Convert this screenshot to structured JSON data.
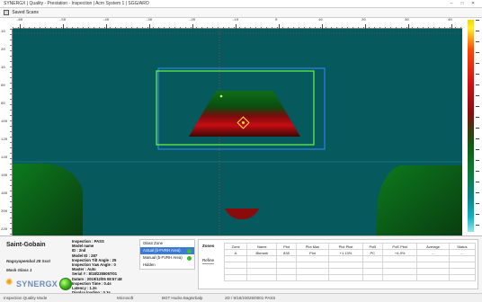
{
  "window": {
    "title": "SYNERGX  |  Quality  -  Prestation  -  Inspection  |  Acm System 1  |  SGG/ARO",
    "controls": [
      "–",
      "□",
      "✕"
    ]
  },
  "toolbar": {
    "label": "Saved Scans"
  },
  "ruler": {
    "top_ticks": [
      "-60",
      "-50",
      "-40",
      "-30",
      "-20",
      "-10",
      "0",
      "10",
      "20",
      "30",
      "40"
    ],
    "left_ticks": [
      "10",
      "20",
      "40",
      "60",
      "80",
      "100",
      "120",
      "140",
      "160",
      "180",
      "200",
      "220"
    ]
  },
  "colors": {
    "plot_bg": "#06595c",
    "dark_green": "#0d5e12",
    "red": "#d40f14",
    "roi_box": "#66ff44",
    "roi_outer": "#3a86ff",
    "marker": "#ffe14d",
    "list_select": "#3b7bd5",
    "status_green": "#3cbc2a"
  },
  "company": {
    "name": "Saint-Gobain",
    "location": "Nagoyapembal 28 Ssst",
    "sub": "Mask Glass 1",
    "logo": "SYNERGX"
  },
  "inspection": {
    "lines": [
      "Inspection : PASS",
      "Model name",
      "ID : 2nd",
      "Model ID : 287",
      "Inspection Tilt Angle : 25",
      "Inspection Yaw Angle : 0",
      "Master : Auto",
      "Serial # : 8/18/2355057/01",
      "Datum : 2019/12/05  08:57:48",
      "Inspection Time : 0.4s",
      "Latency : 1.3s",
      "Display loading : 0.3s"
    ]
  },
  "camera_list": {
    "items": [
      {
        "label": "Glass Zone",
        "selected": false,
        "status": false
      },
      {
        "label": "Actual (b-FVRH Area)",
        "selected": true,
        "status": true
      },
      {
        "label": "Manual (b-FVRH Area)",
        "selected": false,
        "status": true
      },
      {
        "label": "Hidden",
        "selected": false,
        "status": false
      }
    ]
  },
  "zones": {
    "label": "Zones",
    "refine_label": "Refine",
    "headers": [
      "Zone",
      "Name",
      "Plot",
      "Plot Max",
      "Plot Pkst",
      "PoB",
      "PoE Pkst",
      "Average",
      "Status"
    ],
    "rows": [
      [
        "A",
        "Bkmark",
        "835",
        "Plot",
        "+1.13%",
        "PC",
        "+4.9%",
        "...",
        "..."
      ]
    ]
  },
  "status": {
    "left": "Inspection  Quality  Mode",
    "mid1": "Microsoft",
    "mid2": "BGT  Hudra Bagtsrbalp",
    "mid3": "2D / 9/18/23025/0001   PASS"
  }
}
